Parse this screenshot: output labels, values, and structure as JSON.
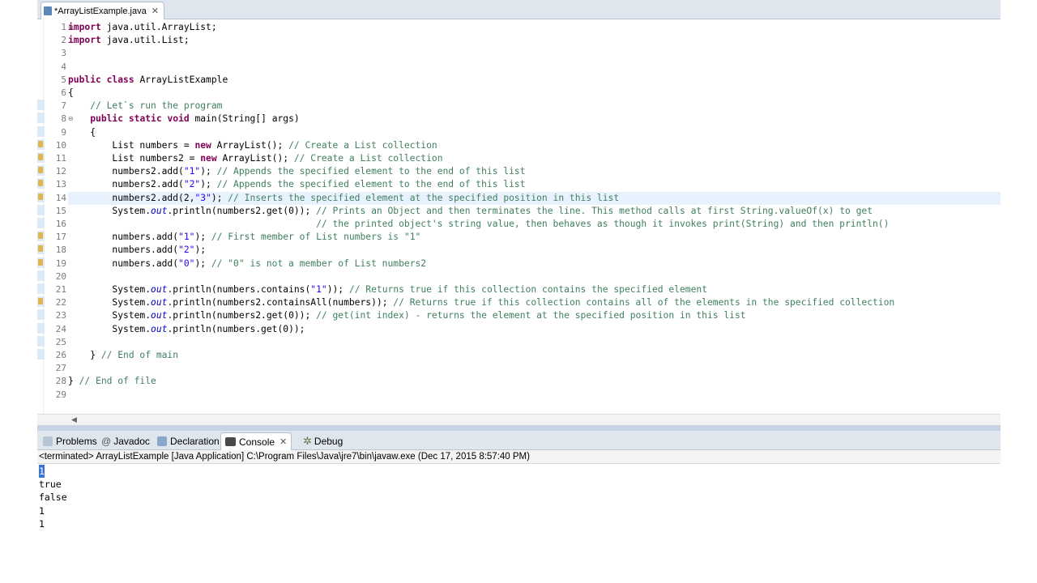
{
  "editor_tab": {
    "title": "*ArrayListExample.java"
  },
  "line_numbers": [
    "1",
    "2",
    "3",
    "4",
    "5",
    "6",
    "7",
    "8",
    "9",
    "10",
    "11",
    "12",
    "13",
    "14",
    "15",
    "16",
    "17",
    "18",
    "19",
    "20",
    "21",
    "22",
    "23",
    "24",
    "25",
    "26",
    "27",
    "28",
    "29"
  ],
  "code": [
    "import java.util.ArrayList;",
    "import java.util.List;",
    "",
    "",
    "public class ArrayListExample",
    "{",
    "    // Let`s run the program",
    "    public static void main(String[] args)",
    "    {",
    "        List numbers = new ArrayList(); // Create a List collection",
    "        List numbers2 = new ArrayList(); // Create a List collection",
    "        numbers2.add(\"1\"); // Appends the specified element to the end of this list",
    "        numbers2.add(\"2\"); // Appends the specified element to the end of this list",
    "        numbers2.add(2,\"3\"); // Inserts the specified element at the specified position in this list",
    "        System.out.println(numbers2.get(0)); // Prints an Object and then terminates the line. This method calls at first String.valueOf(x) to get",
    "                                             // the printed object's string value, then behaves as though it invokes print(String) and then println()",
    "        numbers.add(\"1\"); // First member of List numbers is \"1\"",
    "        numbers.add(\"2\");",
    "        numbers.add(\"0\"); // \"0\" is not a member of List numbers2",
    "",
    "        System.out.println(numbers.contains(\"1\")); // Returns true if this collection contains the specified element",
    "        System.out.println(numbers2.containsAll(numbers)); // Returns true if this collection contains all of the elements in the specified collection",
    "        System.out.println(numbers2.get(0)); // get(int index) - returns the element at the specified position in this list",
    "        System.out.println(numbers.get(0));",
    "",
    "    } // End of main",
    "",
    "} // End of file",
    ""
  ],
  "view_tabs": {
    "problems": "Problems",
    "javadoc": "Javadoc",
    "declaration": "Declaration",
    "console": "Console",
    "debug": "Debug"
  },
  "console": {
    "status": "<terminated> ArrayListExample [Java Application] C:\\Program Files\\Java\\jre7\\bin\\javaw.exe (Dec 17, 2015 8:57:40 PM)",
    "output": [
      "1",
      "true",
      "false",
      "1",
      "1"
    ]
  },
  "colors": {
    "keyword": "#7f0055",
    "comment": "#3f7f5f",
    "string": "#2a00ff",
    "static_field": "#0000c0",
    "tab_bar": "#dfe6ee",
    "selection": "#3875d7"
  }
}
